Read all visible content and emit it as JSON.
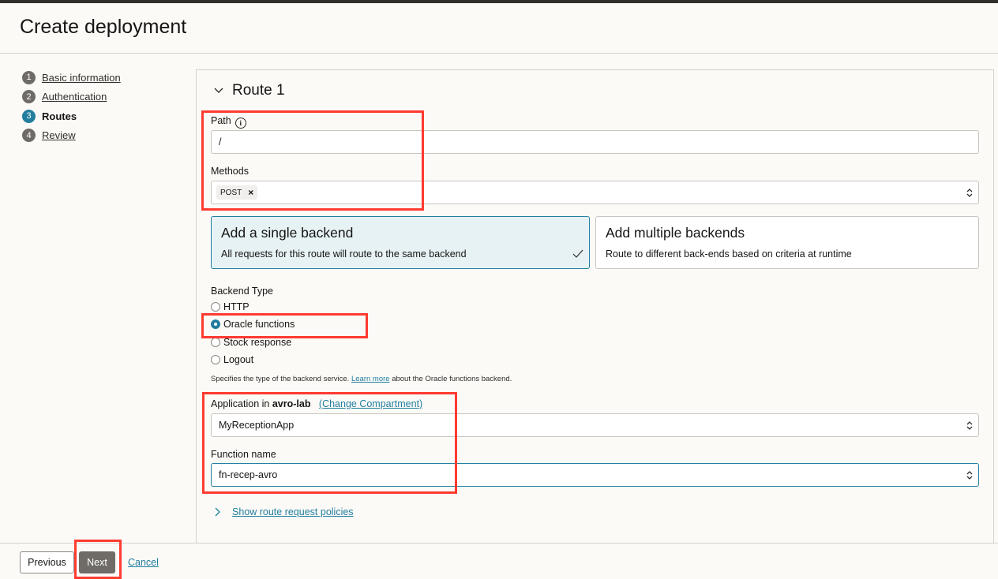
{
  "page": {
    "title": "Create deployment"
  },
  "steps": [
    {
      "num": "1",
      "label": "Basic information"
    },
    {
      "num": "2",
      "label": "Authentication"
    },
    {
      "num": "3",
      "label": "Routes"
    },
    {
      "num": "4",
      "label": "Review"
    }
  ],
  "route": {
    "title": "Route 1",
    "path_label": "Path",
    "path_value": "/",
    "methods_label": "Methods",
    "methods_chip": "POST",
    "single_backend": {
      "title": "Add a single backend",
      "desc": "All requests for this route will route to the same backend"
    },
    "multiple_backends": {
      "title": "Add multiple backends",
      "desc": "Route to different back-ends based on criteria at runtime"
    },
    "backend_type_label": "Backend Type",
    "backend_types": [
      "HTTP",
      "Oracle functions",
      "Stock response",
      "Logout"
    ],
    "selected_backend": "Oracle functions",
    "hint_before": "Specifies the type of the backend service.",
    "hint_link": "Learn more",
    "hint_after": "about the Oracle functions backend.",
    "app_label_prefix": "Application in",
    "app_compartment": "avro-lab",
    "change_compartment": "(Change Compartment)",
    "app_value": "MyReceptionApp",
    "function_label": "Function name",
    "function_value": "fn-recep-avro",
    "show_policies": "Show route request policies"
  },
  "footer": {
    "previous": "Previous",
    "next": "Next",
    "cancel": "Cancel"
  },
  "colors": {
    "accent": "#227e9e",
    "highlight": "#ff3b30"
  }
}
